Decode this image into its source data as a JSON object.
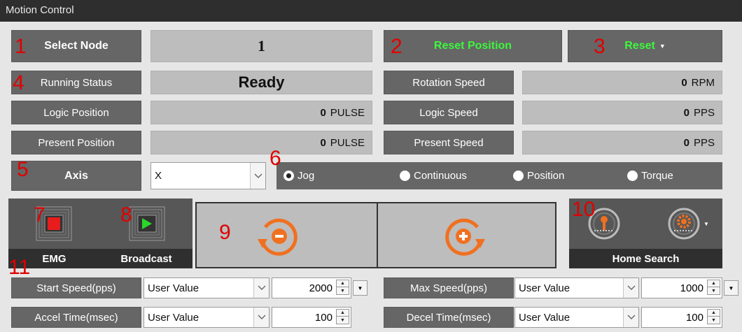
{
  "window": {
    "title": "Motion Control"
  },
  "colors": {
    "label_bg": "#666666",
    "value_bg": "#bdbdbd",
    "accent_green": "#3df73d",
    "accent_orange": "#f07020",
    "marker_red": "#e00000"
  },
  "markers": [
    "1",
    "2",
    "3",
    "4",
    "5",
    "6",
    "7",
    "8",
    "9",
    "10",
    "11"
  ],
  "node": {
    "label": "Select Node",
    "value": "1"
  },
  "reset_position": {
    "label": "Reset Position"
  },
  "reset": {
    "label": "Reset"
  },
  "status": {
    "running_label": "Running Status",
    "running_value": "Ready",
    "logic_position_label": "Logic Position",
    "logic_position_value": "0",
    "logic_position_unit": "PULSE",
    "present_position_label": "Present Position",
    "present_position_value": "0",
    "present_position_unit": "PULSE",
    "rotation_speed_label": "Rotation Speed",
    "rotation_speed_value": "0",
    "rotation_speed_unit": "RPM",
    "logic_speed_label": "Logic Speed",
    "logic_speed_value": "0",
    "logic_speed_unit": "PPS",
    "present_speed_label": "Present Speed",
    "present_speed_value": "0",
    "present_speed_unit": "PPS"
  },
  "axis": {
    "label": "Axis",
    "value": "X"
  },
  "modes": [
    {
      "label": "Jog",
      "selected": true
    },
    {
      "label": "Continuous",
      "selected": false
    },
    {
      "label": "Position",
      "selected": false
    },
    {
      "label": "Torque",
      "selected": false
    }
  ],
  "controls": {
    "emg_label": "EMG",
    "broadcast_label": "Broadcast",
    "home_search_label": "Home Search"
  },
  "params": {
    "start_speed_label": "Start Speed(pps)",
    "start_speed_mode": "User Value",
    "start_speed_value": "2000",
    "max_speed_label": "Max Speed(pps)",
    "max_speed_mode": "User Value",
    "max_speed_value": "1000",
    "accel_time_label": "Accel Time(msec)",
    "accel_time_mode": "User Value",
    "accel_time_value": "100",
    "decel_time_label": "Decel Time(msec)",
    "decel_time_mode": "User Value",
    "decel_time_value": "100"
  }
}
